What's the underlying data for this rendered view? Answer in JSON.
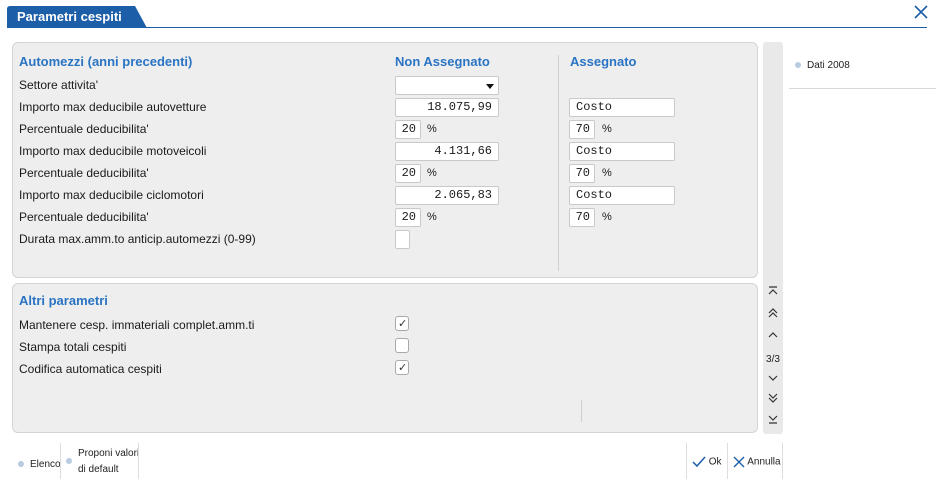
{
  "window": {
    "title": "Parametri cespiti"
  },
  "section_automezzi": {
    "title": "Automezzi (anni precedenti)",
    "col_non_assegnato": "Non Assegnato",
    "col_assegnato": "Assegnato",
    "rows": {
      "settore": "Settore attivita'",
      "autovetture": "Importo max deducibile autovetture",
      "perc1": "Percentuale deducibilita'",
      "motoveicoli": "Importo max deducibile motoveicoli",
      "perc2": "Percentuale deducibilita'",
      "ciclomotori": "Importo max deducibile ciclomotori",
      "perc3": "Percentuale deducibilita'",
      "durata": "Durata max.amm.to anticip.automezzi (0-99)"
    },
    "values": {
      "autovetture_non": "18.075,99",
      "autovetture_ass": "Costo",
      "perc1_non": "20",
      "perc1_ass": "70",
      "motoveicoli_non": "4.131,66",
      "motoveicoli_ass": "Costo",
      "perc2_non": "20",
      "perc2_ass": "70",
      "ciclomotori_non": "2.065,83",
      "ciclomotori_ass": "Costo",
      "perc3_non": "20",
      "perc3_ass": "70",
      "percent_sign": "%"
    }
  },
  "section_altri": {
    "title": "Altri parametri",
    "rows": {
      "mantenere": "Mantenere cesp. immateriali complet.amm.ti",
      "stampa": "Stampa totali cespiti",
      "codifica": "Codifica automatica cespiti"
    },
    "checked": {
      "mantenere": true,
      "stampa": false,
      "codifica": true
    }
  },
  "nav": {
    "page_indicator": "3/3"
  },
  "side_panel": {
    "item": "Dati 2008"
  },
  "bottom": {
    "elenco": "Elenco",
    "proponi_line1": "Proponi valori",
    "proponi_line2": "di default",
    "ok": "Ok",
    "annulla": "Annulla"
  },
  "colors": {
    "accent": "#1d5ea8",
    "section_title": "#2a74c4",
    "panel_bg": "#eeeeee"
  }
}
